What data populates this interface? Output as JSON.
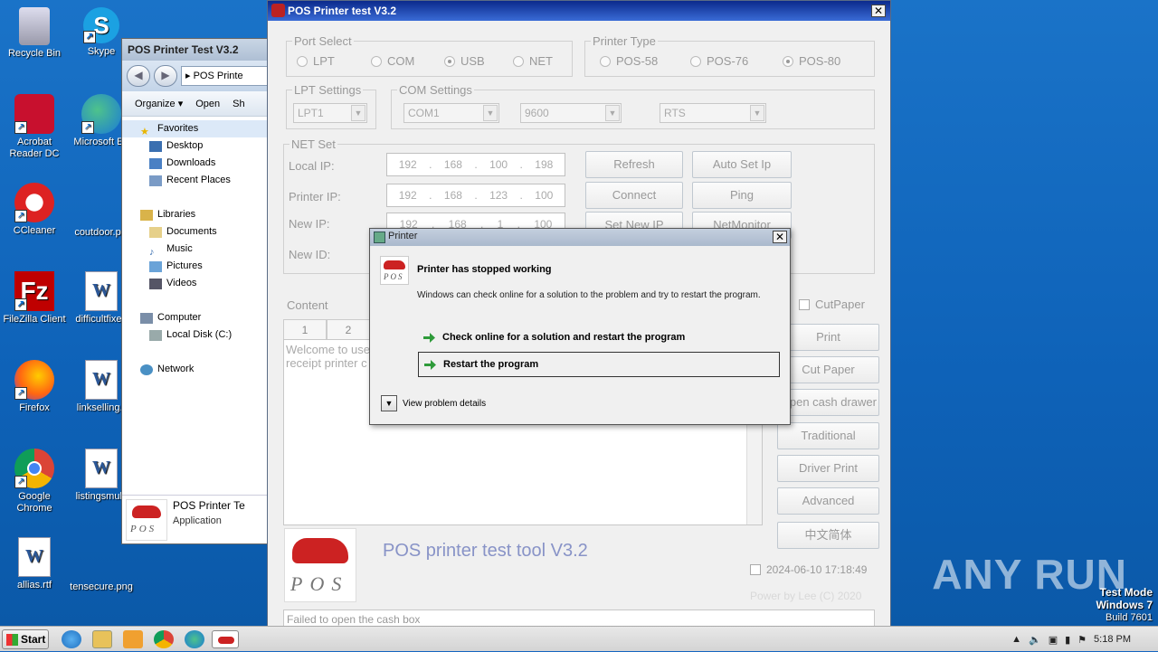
{
  "desktop": {
    "icons": [
      {
        "label": "Recycle Bin"
      },
      {
        "label": "Skype"
      },
      {
        "label": "Acrobat Reader DC"
      },
      {
        "label": "Microsoft Ed"
      },
      {
        "label": "CCleaner"
      },
      {
        "label": "coutdoor.p"
      },
      {
        "label": "FileZilla Client"
      },
      {
        "label": "difficultfixed"
      },
      {
        "label": "Firefox"
      },
      {
        "label": "linkselling.r"
      },
      {
        "label": "Google Chrome"
      },
      {
        "label": "listingsmulti"
      },
      {
        "label": "allias.rtf"
      },
      {
        "label": "tensecure.png"
      }
    ],
    "watermark": "ANY RUN",
    "test_mode": {
      "line1": "Test Mode",
      "line2": "Windows 7",
      "line3": "Build 7601"
    }
  },
  "explorer": {
    "title": "POS Printer Test V3.2",
    "address": "POS Printe",
    "toolbar": {
      "organize": "Organize",
      "open": "Open",
      "share": "Sh"
    },
    "tree": [
      "Favorites",
      "Desktop",
      "Downloads",
      "Recent Places",
      "Libraries",
      "Documents",
      "Music",
      "Pictures",
      "Videos",
      "Computer",
      "Local Disk (C:)",
      "Network"
    ],
    "detail": {
      "name": "POS Printer Te",
      "type": "Application"
    }
  },
  "pos": {
    "title": "POS Printer test V3.2",
    "port_select": {
      "label": "Port Select",
      "options": [
        "LPT",
        "COM",
        "USB",
        "NET"
      ],
      "selected": "USB"
    },
    "printer_type": {
      "label": "Printer Type",
      "options": [
        "POS-58",
        "POS-76",
        "POS-80"
      ],
      "selected": "POS-80"
    },
    "lpt_settings": {
      "label": "LPT Settings",
      "value": "LPT1"
    },
    "com_settings": {
      "label": "COM Settings",
      "port": "COM1",
      "baud": "9600",
      "flow": "RTS"
    },
    "net_set": {
      "label": "NET Set",
      "local_ip_label": "Local IP:",
      "local_ip": [
        "192",
        "168",
        "100",
        "198"
      ],
      "printer_ip_label": "Printer IP:",
      "printer_ip": [
        "192",
        "168",
        "123",
        "100"
      ],
      "new_ip_label": "New IP:",
      "new_ip": [
        "192",
        "168",
        "1",
        "100"
      ],
      "new_id_label": "New ID:"
    },
    "buttons": {
      "refresh": "Refresh",
      "auto_set_ip": "Auto Set Ip",
      "connect": "Connect",
      "ping": "Ping",
      "set_new_ip": "Set New IP",
      "net_monitor": "NetMonitor"
    },
    "content_label": "Content",
    "tabs": [
      "1",
      "2"
    ],
    "content_text": "Welcome to use\nreceipt printer c",
    "cut_paper_check": "CutPaper",
    "side_buttons": [
      "Print",
      "Cut Paper",
      "Open cash drawer",
      "Traditional",
      "Driver Print",
      "Advanced",
      "中文简体"
    ],
    "banner_title": "POS printer test tool V3.2",
    "timestamp": "2024-06-10 17:18:49",
    "powered": "Power by Lee (C) 2020",
    "status": "Failed to open the cash box"
  },
  "dialog": {
    "title": "Printer",
    "heading": "Printer has stopped working",
    "text": "Windows can check online for a solution to the problem and try to restart the program.",
    "option1": "Check online for a solution and restart the program",
    "option2": "Restart the program",
    "details": "View problem details"
  },
  "taskbar": {
    "start": "Start",
    "time": "5:18 PM"
  }
}
